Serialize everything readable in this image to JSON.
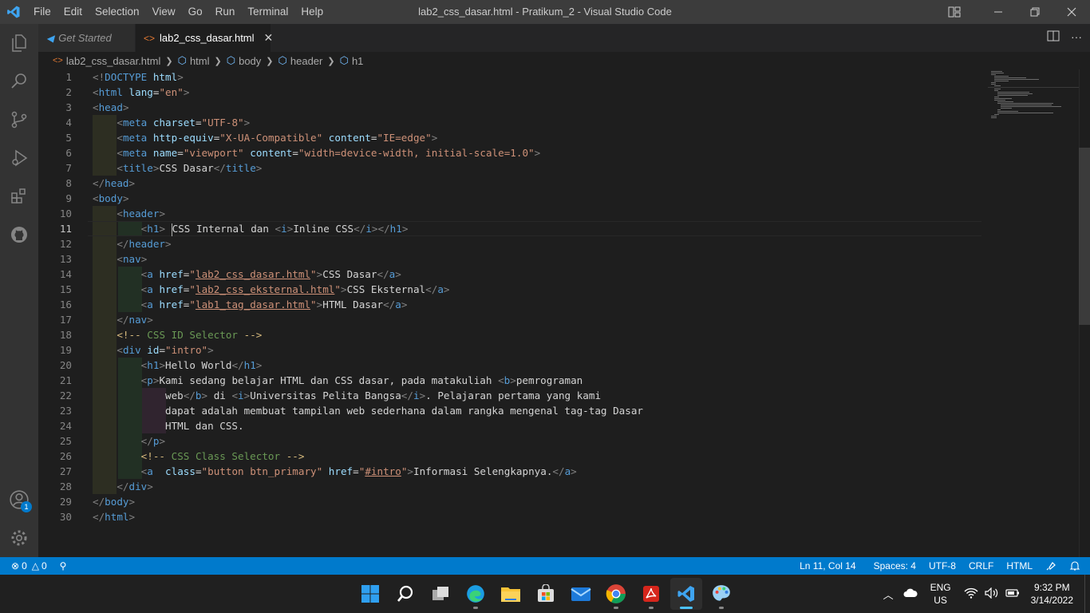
{
  "window": {
    "title": "lab2_css_dasar.html - Pratikum_2 - Visual Studio Code",
    "menu": [
      "File",
      "Edit",
      "Selection",
      "View",
      "Go",
      "Run",
      "Terminal",
      "Help"
    ]
  },
  "activity_bar": {
    "items": [
      "explorer-icon",
      "search-icon",
      "source-control-icon",
      "run-debug-icon",
      "extensions-icon",
      "github-icon"
    ],
    "accounts_badge": "1"
  },
  "tabs": [
    {
      "label": "Get Started",
      "active": false
    },
    {
      "label": "lab2_css_dasar.html",
      "active": true,
      "close": "✕"
    }
  ],
  "breadcrumb": [
    "lab2_css_dasar.html",
    "html",
    "body",
    "header",
    "h1"
  ],
  "editor": {
    "current_line": 11,
    "line_numbers": [
      "1",
      "2",
      "3",
      "4",
      "5",
      "6",
      "7",
      "8",
      "9",
      "10",
      "11",
      "12",
      "13",
      "14",
      "15",
      "16",
      "17",
      "18",
      "19",
      "20",
      "21",
      "22",
      "23",
      "24",
      "25",
      "26",
      "27",
      "28",
      "29",
      "30"
    ],
    "code": {
      "doctype": "DOCTYPE",
      "html": "html",
      "lang_attr": "lang",
      "lang_val": "\"en\"",
      "head": "head",
      "meta": "meta",
      "charset_attr": "charset",
      "charset_val": "\"UTF-8\"",
      "http_equiv_attr": "http-equiv",
      "http_equiv_val": "\"X-UA-Compatible\"",
      "content_attr": "content",
      "content_val_ie": "\"IE=edge\"",
      "name_attr": "name",
      "name_val": "\"viewport\"",
      "content_val_vp": "\"width=device-width, initial-scale=1.0\"",
      "title": "title",
      "title_text": "CSS Dasar",
      "body": "body",
      "header": "header",
      "h1": "h1",
      "h1_text_a": "CSS Internal dan ",
      "i": "i",
      "h1_text_b": "Inline CSS",
      "nav": "nav",
      "a": "a",
      "href_attr": "href",
      "link1_href": "lab2_css_dasar.html",
      "link1_text": "CSS Dasar",
      "link2_href": "lab2_css_eksternal.html",
      "link2_text": "CSS Eksternal",
      "link3_href": "lab1_tag_dasar.html",
      "link3_text": "HTML Dasar",
      "comment1": "CSS ID Selector",
      "div": "div",
      "id_attr": "id",
      "id_val": "\"intro\"",
      "hello": "Hello World",
      "p": "p",
      "b": "b",
      "p_text1": "Kami sedang belajar HTML dan CSS dasar, pada matakuliah ",
      "p_bold": "pemrograman",
      "p_bold2": "web",
      "p_text2": " di ",
      "p_italic": "Universitas Pelita Bangsa",
      "p_text3": ". Pelajaran pertama yang kami",
      "p_text4": "dapat adalah membuat tampilan web sederhana dalam rangka mengenal tag-tag Dasar",
      "p_text5": "HTML dan CSS.",
      "comment2": "CSS Class Selector",
      "class_attr": "class",
      "class_val": "\"button btn_primary\"",
      "intro_href": "#intro",
      "more_text": "Informasi Selengkapnya."
    }
  },
  "status_bar": {
    "errors": "0",
    "warnings": "0",
    "position": "Ln 11, Col 14",
    "spaces": "Spaces: 4",
    "encoding": "UTF-8",
    "eol": "CRLF",
    "language": "HTML"
  },
  "taskbar": {
    "apps": [
      "start-icon",
      "search-icon",
      "task-view-icon",
      "edge-icon",
      "file-explorer-icon",
      "store-icon",
      "mail-icon",
      "chrome-icon",
      "acrobat-icon",
      "vscode-icon",
      "paint-icon"
    ],
    "lang_top": "ENG",
    "lang_bottom": "US",
    "time": "9:32 PM",
    "date": "3/14/2022"
  },
  "colors": {
    "accent": "#007acc",
    "editor_bg": "#1e1e1e",
    "tag": "#569cd6",
    "attr": "#9cdcfe",
    "string": "#ce9178",
    "comment": "#6a9955"
  }
}
